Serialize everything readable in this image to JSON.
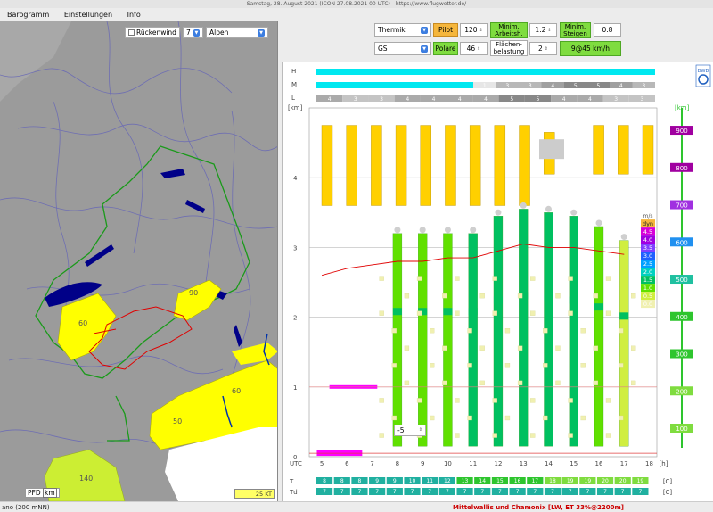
{
  "window": {
    "title": "Samstag, 28. August 2021 (ICON 27.08.2021 00 UTC) - https://www.flugwetter.de/"
  },
  "menu": [
    "Barogramm",
    "Einstellungen",
    "Info"
  ],
  "map": {
    "tailwind_label": "Rückenwind",
    "tailwind_checked": false,
    "tailwind_value": "7",
    "region": "Alpen",
    "labels": [
      "90",
      "60",
      "60",
      "50",
      "140"
    ],
    "pfd": "PFD",
    "unit": "km",
    "wind_legend": "25 KT"
  },
  "controls": {
    "mode": "Thermik",
    "pilot_label": "Pilot",
    "pilot_value": "120",
    "min_arbeitsh_label": "Minim. Arbeitsh.",
    "min_arbeitsh_value": "1.2",
    "min_steigen_label": "Minim. Steigen",
    "min_steigen_value": "0.8",
    "type": "GS",
    "polare_label": "Polare",
    "polare_value": "46",
    "flaechen_label": "Flächen-belastung",
    "flaechen_value": "2",
    "result": "9@45 km/h"
  },
  "chart_data": {
    "type": "heatmap",
    "title": "",
    "xlabel": "UTC",
    "x_unit": "[h]",
    "y_unit_left": "[km]",
    "y_unit_right": "[km]",
    "hours": [
      5,
      6,
      7,
      8,
      9,
      10,
      11,
      12,
      13,
      14,
      15,
      16,
      17,
      18
    ],
    "y_ticks_left": [
      0,
      1,
      2,
      3,
      4
    ],
    "y_ticks_right": [
      100,
      200,
      300,
      400,
      500,
      600,
      700,
      800,
      900
    ],
    "ylim": [
      0,
      5
    ],
    "cloud_rows": [
      "H",
      "M",
      "L"
    ],
    "low_cloud_values": [
      "4",
      "3",
      "3",
      "4",
      "4",
      "4",
      "4",
      "5",
      "5",
      "4",
      "4",
      "3",
      "3"
    ],
    "mid_cloud_values": [
      "",
      "",
      "",
      "",
      "",
      "1",
      "3",
      "3",
      "4",
      "5",
      "5",
      "4",
      "3",
      "3"
    ],
    "legend_title": "m/s",
    "legend": [
      {
        "label": "dyn",
        "color": "#f5b63c"
      },
      {
        "label": "4.5",
        "color": "#d800d8"
      },
      {
        "label": "4.0",
        "color": "#a000e0"
      },
      {
        "label": "3.5",
        "color": "#8040ff"
      },
      {
        "label": "3.0",
        "color": "#2060ff"
      },
      {
        "label": "2.5",
        "color": "#00a0ff"
      },
      {
        "label": "2.0",
        "color": "#00d0c0"
      },
      {
        "label": "1.5",
        "color": "#00c060"
      },
      {
        "label": "1.0",
        "color": "#60e000"
      },
      {
        "label": "0.5",
        "color": "#d0ee40"
      },
      {
        "label": "0.0",
        "color": "#f0f0b0"
      }
    ],
    "thermal_top_km": [
      2.6,
      2.7,
      2.75,
      2.8,
      2.8,
      2.85,
      2.85,
      2.95,
      3.05,
      3.0,
      3.0,
      2.95,
      2.9
    ],
    "updraft_series": [
      {
        "hour": 8,
        "top": 3.2,
        "color": "#60e000"
      },
      {
        "hour": 9,
        "top": 3.2,
        "color": "#60e000"
      },
      {
        "hour": 10,
        "top": 3.2,
        "color": "#60e000"
      },
      {
        "hour": 11,
        "top": 3.2,
        "color": "#00c060"
      },
      {
        "hour": 12,
        "top": 3.45,
        "color": "#00c060"
      },
      {
        "hour": 13,
        "top": 3.55,
        "color": "#00c060"
      },
      {
        "hour": 14,
        "top": 3.5,
        "color": "#00c060"
      },
      {
        "hour": 15,
        "top": 3.45,
        "color": "#00c060"
      },
      {
        "hour": 16,
        "top": 3.3,
        "color": "#60e000"
      },
      {
        "hour": 17,
        "top": 3.1,
        "color": "#d0ee40"
      }
    ],
    "T_label": "T",
    "Td_label": "Td",
    "temp_unit": "[C]",
    "T_values": [
      "8",
      "8",
      "8",
      "9",
      "9",
      "10",
      "11",
      "12",
      "13",
      "14",
      "15",
      "16",
      "17",
      "18",
      "19",
      "19",
      "20",
      "20",
      "19"
    ],
    "Td_values": [
      "7",
      "7",
      "7",
      "7",
      "7",
      "7",
      "7",
      "7",
      "7",
      "7",
      "7",
      "7",
      "7",
      "7",
      "7",
      "7",
      "7",
      "7",
      "7"
    ],
    "dwd_label": "DWD"
  },
  "offset": "-5",
  "status": {
    "left": "ano (200 mNN)",
    "right": "Mittelwallis und Chamonix [LW, ET  33%@2200m]"
  }
}
